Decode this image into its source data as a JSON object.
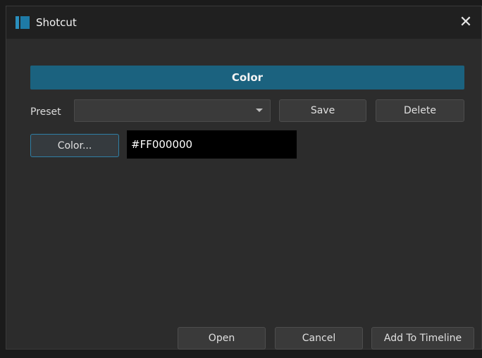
{
  "window": {
    "title": "Shotcut",
    "close_glyph": "✕",
    "icon": "shotcut-logo-icon",
    "accent": "#1b627f"
  },
  "header": {
    "label": "Color"
  },
  "preset": {
    "label": "Preset",
    "selected": "",
    "save_label": "Save",
    "delete_label": "Delete"
  },
  "color": {
    "button_label": "Color...",
    "value": "#FF000000"
  },
  "footer": {
    "open_label": "Open",
    "cancel_label": "Cancel",
    "add_label": "Add To Timeline"
  }
}
